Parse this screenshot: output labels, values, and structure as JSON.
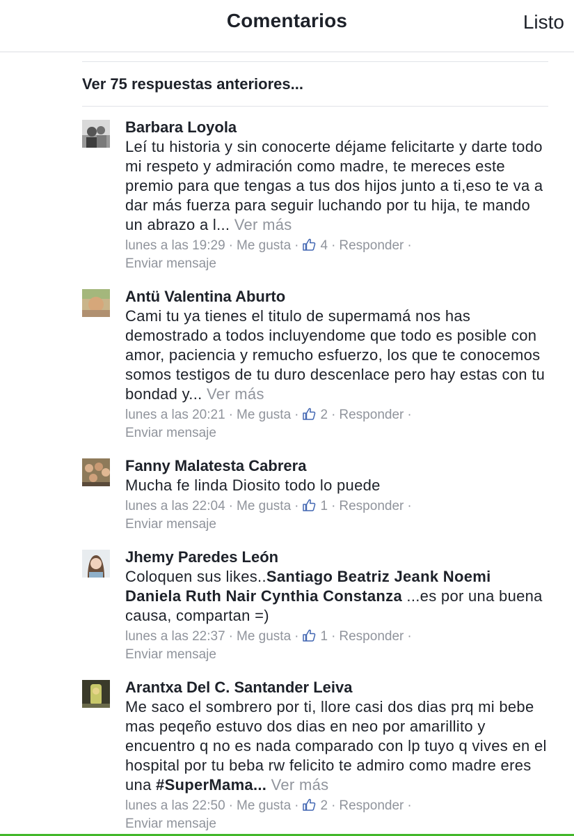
{
  "header": {
    "title": "Comentarios",
    "done_label": "Listo"
  },
  "previous_replies_label": "Ver 75 respuestas anteriores...",
  "meta_labels": {
    "like": "Me gusta",
    "reply": "Responder",
    "send_message": "Enviar mensaje",
    "see_more": "Ver más"
  },
  "comments": [
    {
      "author": "Barbara Loyola",
      "text": "Leí tu historia y sin conocerte déjame felicitarte y darte todo mi respeto y admiración como madre, te mereces este premio para que tengas a tus dos hijos junto a ti,eso te va a dar más fuerza para seguir luchando por tu hija, te mando un abrazo a l...",
      "time": "lunes a las 19:29",
      "likes": "4"
    },
    {
      "author": "Antü Valentina Aburto",
      "text": "Cami tu ya tienes el titulo de supermamá nos has demostrado a todos incluyendome que todo es posible con amor, paciencia y remucho esfuerzo, los que te conocemos somos testigos de tu duro descenlace pero hay estas con tu bondad y...",
      "time": "lunes a las 20:21",
      "likes": "2"
    },
    {
      "author": "Fanny Malatesta Cabrera",
      "text": "Mucha fe linda Diosito todo lo puede",
      "time": "lunes a las 22:04",
      "likes": "1"
    },
    {
      "author": "Jhemy Paredes León",
      "text_before": "Coloquen sus likes..",
      "tags": "Santiago Beatriz Jeank Noemi Daniela Ruth Nair Cynthia Constanza",
      "text_after": " ...es por una buena causa, compartan =)",
      "time": "lunes a las 22:37",
      "likes": "1"
    },
    {
      "author": "Arantxa Del C. Santander Leiva",
      "text": "Me saco el sombrero por ti, llore casi dos dias prq mi bebe mas peqeño estuvo dos dias en neo por amarillito y encuentro q no es nada comparado con lp tuyo q vives en el hospital por tu beba rw felicito te admiro como madre eres una ",
      "hashtag": "#SuperMama...",
      "time": "lunes a las 22:50",
      "likes": "2"
    }
  ],
  "colors": {
    "text": "#1d2129",
    "muted": "#90949c",
    "like_blue": "#4267b2",
    "divider": "#e1e3e8"
  }
}
